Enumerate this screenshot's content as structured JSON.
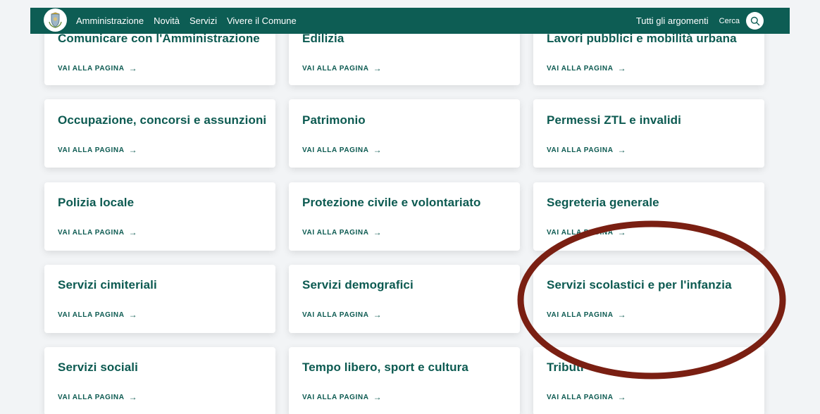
{
  "header": {
    "logo_icon": "municipal-crest-icon",
    "nav": [
      "Amministrazione",
      "Novità",
      "Servizi",
      "Vivere il Comune"
    ],
    "topics_label": "Tutti gli argomenti",
    "search_label": "Cerca",
    "search_icon": "search-icon"
  },
  "cards": [
    {
      "title": "Comunicare con l'Amministrazione",
      "link": "VAI ALLA PAGINA"
    },
    {
      "title": "Edilizia",
      "link": "VAI ALLA PAGINA"
    },
    {
      "title": "Lavori pubblici e mobilità urbana",
      "link": "VAI ALLA PAGINA"
    },
    {
      "title": "Occupazione, concorsi e assunzioni",
      "link": "VAI ALLA PAGINA"
    },
    {
      "title": "Patrimonio",
      "link": "VAI ALLA PAGINA"
    },
    {
      "title": "Permessi ZTL e invalidi",
      "link": "VAI ALLA PAGINA"
    },
    {
      "title": "Polizia locale",
      "link": "VAI ALLA PAGINA"
    },
    {
      "title": "Protezione civile e volontariato",
      "link": "VAI ALLA PAGINA"
    },
    {
      "title": "Segreteria generale",
      "link": "VAI ALLA PAGINA"
    },
    {
      "title": "Servizi cimiteriali",
      "link": "VAI ALLA PAGINA"
    },
    {
      "title": "Servizi demografici",
      "link": "VAI ALLA PAGINA"
    },
    {
      "title": "Servizi scolastici e per l'infanzia",
      "link": "VAI ALLA PAGINA"
    },
    {
      "title": "Servizi sociali",
      "link": "VAI ALLA PAGINA"
    },
    {
      "title": "Tempo libero, sport e cultura",
      "link": "VAI ALLA PAGINA"
    },
    {
      "title": "Tributi",
      "link": "VAI ALLA PAGINA"
    }
  ],
  "colors": {
    "brand": "#0d5d54",
    "text": "#0c5a51",
    "annotation": "#7a1f12"
  }
}
